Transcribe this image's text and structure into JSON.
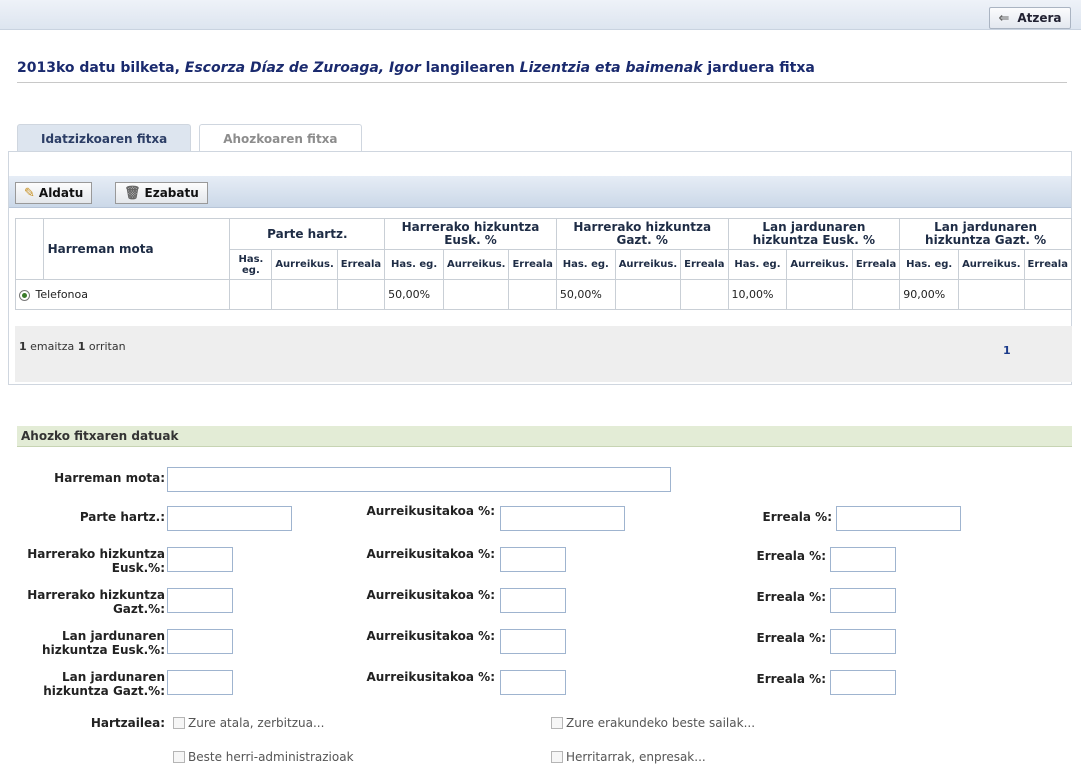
{
  "topbar": {
    "back_label": "Atzera",
    "back_icon": "back-arrow-icon"
  },
  "heading": {
    "part1": "2013ko datu bilketa, ",
    "person": "Escorza Díaz de Zuroaga, Igor",
    "part2": " langilearen ",
    "activity": "Lizentzia eta baimenak",
    "part3": " jarduera fitxa"
  },
  "tabs": [
    {
      "label": "Idatzizkoaren fitxa"
    },
    {
      "label": "Ahozkoaren fitxa"
    }
  ],
  "toolbar": {
    "edit_label": "Aldatu",
    "delete_label": "Ezabatu"
  },
  "table": {
    "col_mota": "Harreman mota",
    "groups": [
      "Parte hartz.",
      "Harrerako hizkuntza Eusk. %",
      "Harrerako hizkuntza Gazt. %",
      "Lan jardunaren hizkuntza Eusk. %",
      "Lan jardunaren hizkuntza Gazt. %"
    ],
    "sub": [
      "Has. eg.",
      "Aurreikus.",
      "Erreala"
    ],
    "rows": [
      {
        "mota": "Telefonoa",
        "cells": [
          "",
          "",
          "",
          "50,00%",
          "",
          "",
          "50,00%",
          "",
          "",
          "10,00%",
          "",
          "",
          "90,00%",
          "",
          ""
        ]
      }
    ]
  },
  "pager": {
    "count": "1",
    "middle": " emaitza ",
    "pages": "1",
    "suffix": " orritan",
    "current": "1"
  },
  "form": {
    "section_title": "Ahozko fitxaren datuak",
    "harreman_mota": "Harreman mota:",
    "parte_hartz": "Parte hartz.:",
    "aurreikusitakoa": "Aurreikusitakoa %:",
    "erreala": "Erreala %:",
    "rows": [
      {
        "label": "Harrerako hizkuntza Eusk.%:"
      },
      {
        "label": "Harrerako hizkuntza Gazt.%:"
      },
      {
        "label": "Lan jardunaren hizkuntza Eusk.%:"
      },
      {
        "label": "Lan jardunaren hizkuntza Gazt.%:"
      }
    ],
    "hartzailea": "Hartzailea:",
    "checkboxes": [
      "Zure atala, zerbitzua...",
      "Zure erakundeko beste sailak...",
      "Beste herri-administrazioak",
      "Herritarrak, enpresak..."
    ]
  }
}
